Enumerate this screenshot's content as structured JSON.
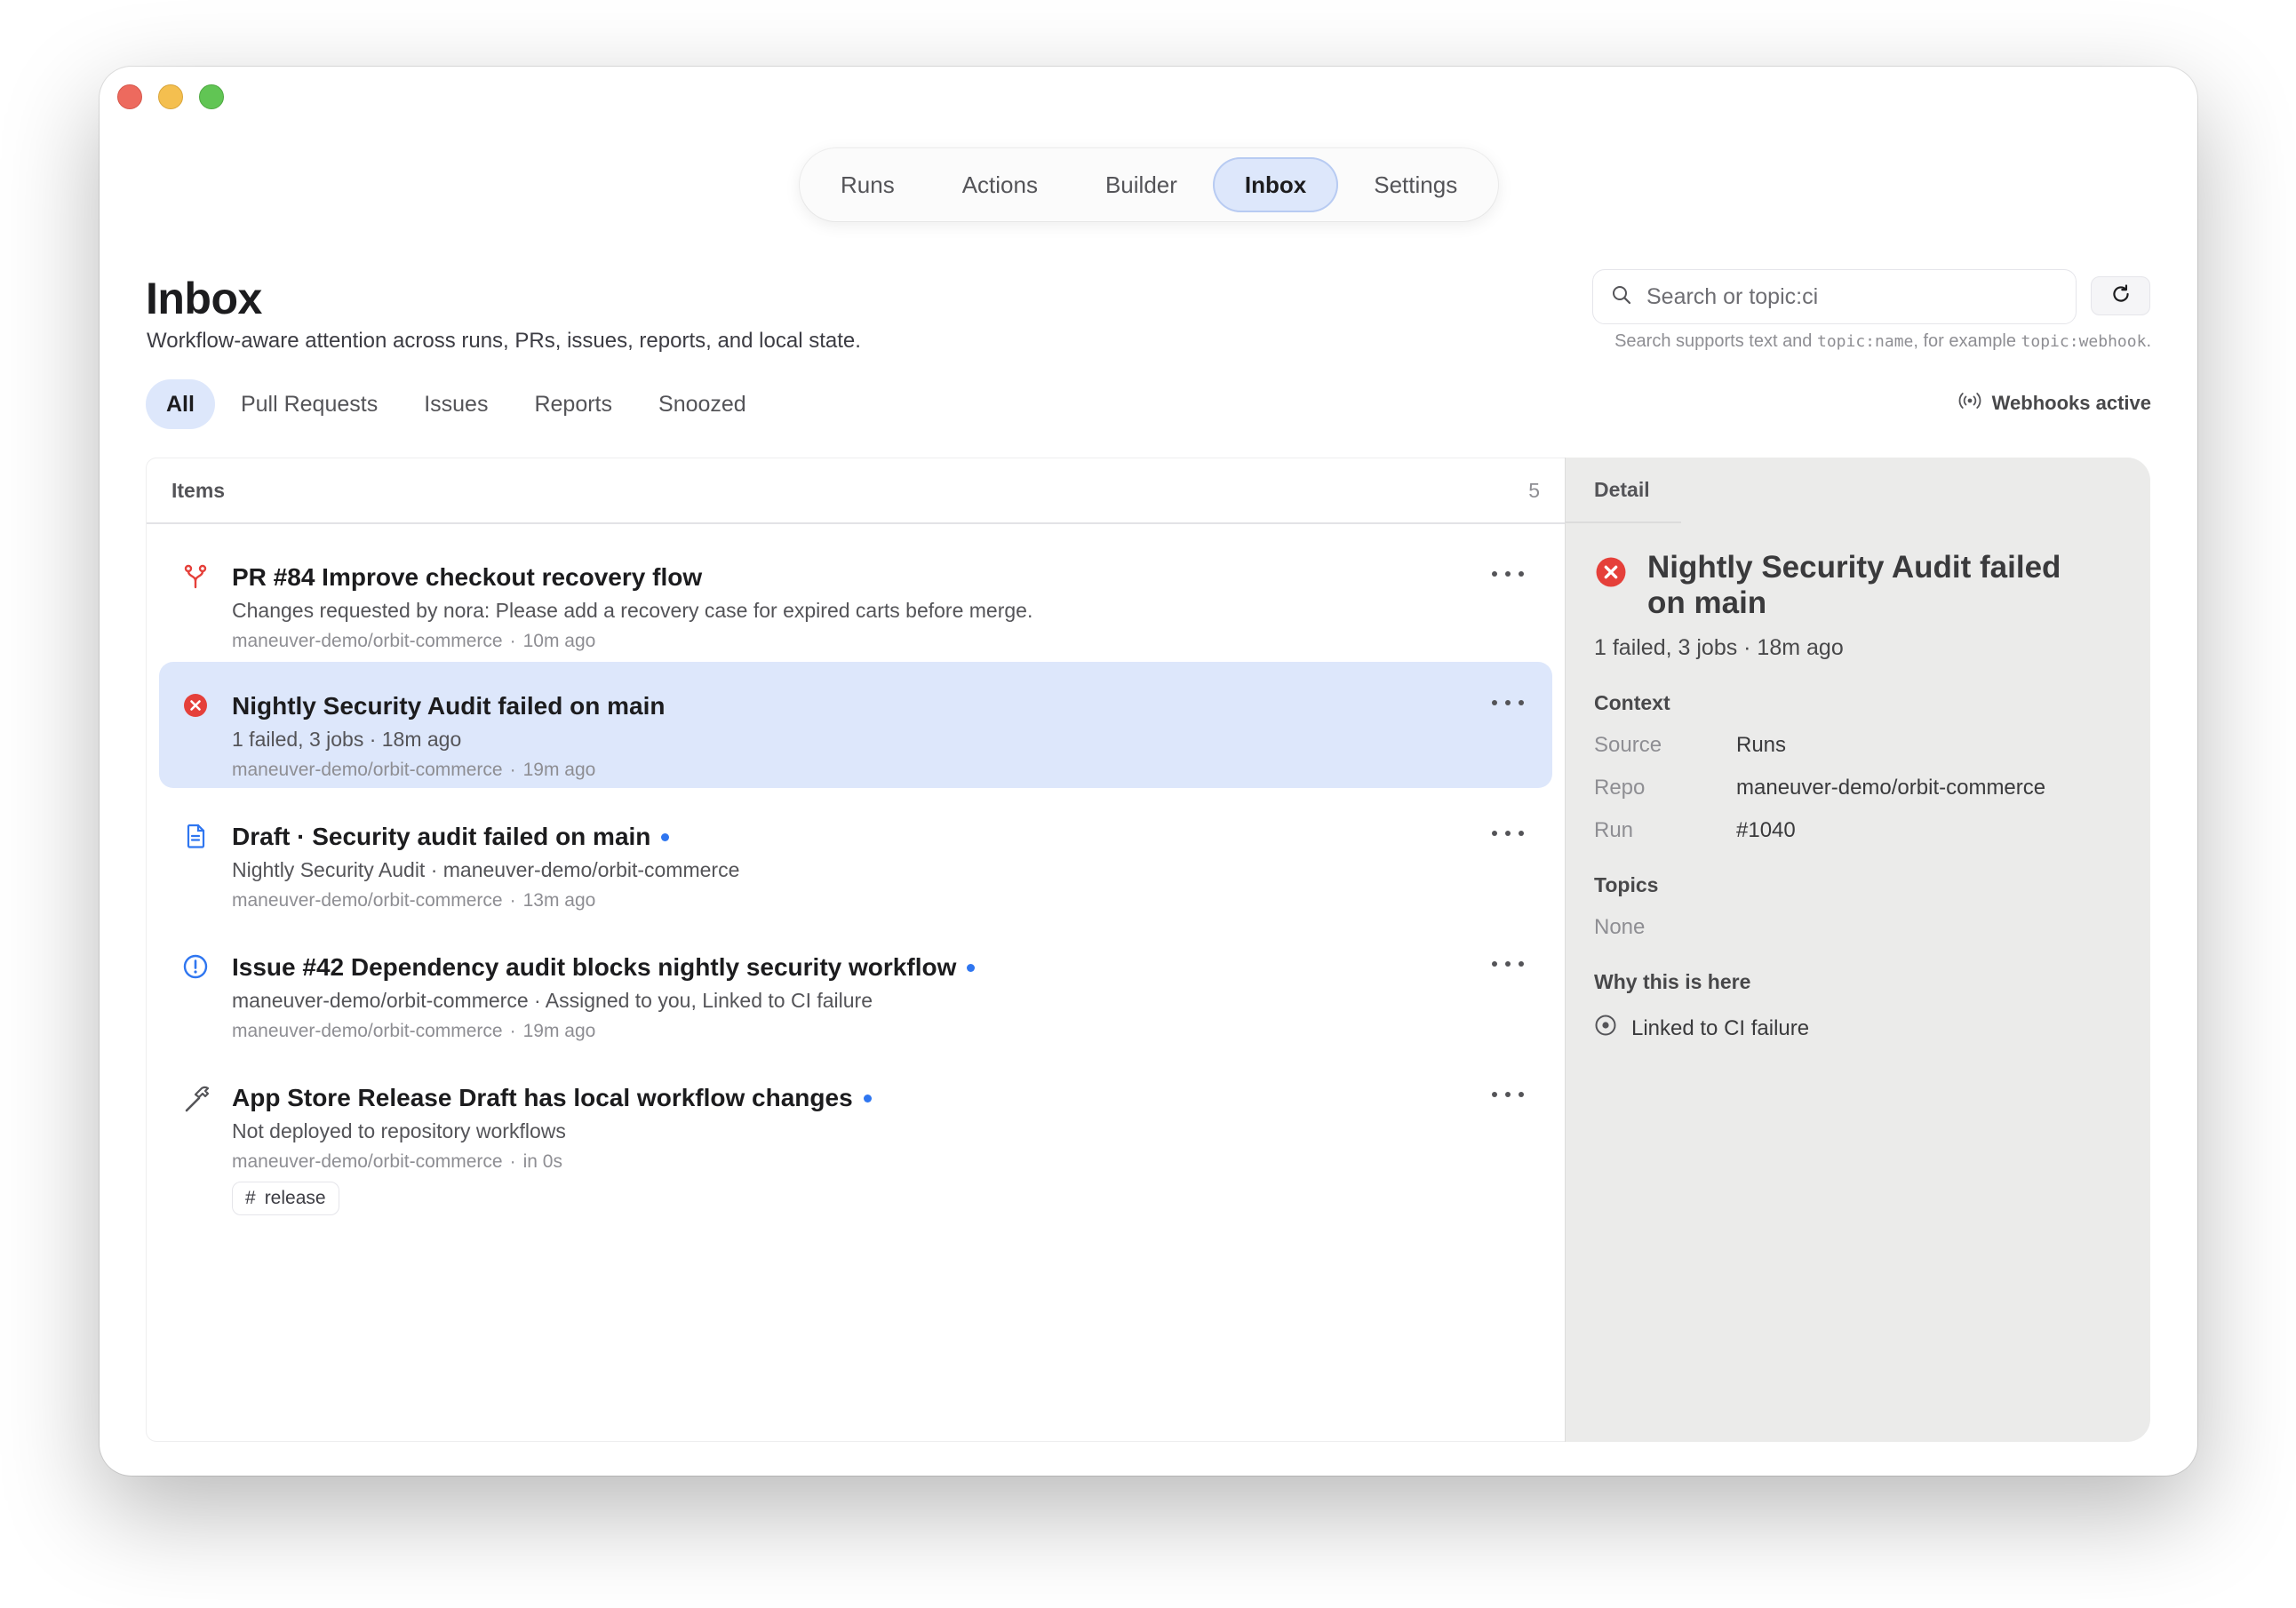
{
  "nav": {
    "tabs": [
      {
        "label": "Runs"
      },
      {
        "label": "Actions"
      },
      {
        "label": "Builder"
      },
      {
        "label": "Inbox",
        "active": true
      },
      {
        "label": "Settings"
      }
    ]
  },
  "page": {
    "title": "Inbox",
    "subtitle": "Workflow-aware attention across runs, PRs, issues, reports, and local state."
  },
  "search": {
    "placeholder": "Search or topic:ci",
    "hint_prefix": "Search supports text and ",
    "hint_code1": "topic:name",
    "hint_middle": ", for example ",
    "hint_code2": "topic:webhook",
    "hint_suffix": "."
  },
  "filters": [
    {
      "label": "All",
      "active": true
    },
    {
      "label": "Pull Requests"
    },
    {
      "label": "Issues"
    },
    {
      "label": "Reports"
    },
    {
      "label": "Snoozed"
    }
  ],
  "webhooks": {
    "label": "Webhooks active"
  },
  "list": {
    "header": "Items",
    "count": "5",
    "items": [
      {
        "icon": "pull-request-icon",
        "title": "PR #84 Improve checkout recovery flow",
        "description": "Changes requested by nora: Please add a recovery case for expired carts before merge.",
        "repo": "maneuver-demo/orbit-commerce",
        "time": "10m ago",
        "unread": false
      },
      {
        "icon": "failed-icon",
        "title": "Nightly Security Audit failed on main",
        "description": "1 failed, 3 jobs · 18m ago",
        "repo": "maneuver-demo/orbit-commerce",
        "time": "19m ago",
        "unread": false,
        "selected": true
      },
      {
        "icon": "document-icon",
        "title": "Draft · Security audit failed on main",
        "description": "Nightly Security Audit · maneuver-demo/orbit-commerce",
        "repo": "maneuver-demo/orbit-commerce",
        "time": "13m ago",
        "unread": true
      },
      {
        "icon": "issue-icon",
        "title": "Issue #42 Dependency audit blocks nightly security workflow",
        "description": "maneuver-demo/orbit-commerce · Assigned to you, Linked to CI failure",
        "repo": "maneuver-demo/orbit-commerce",
        "time": "19m ago",
        "unread": true
      },
      {
        "icon": "hammer-icon",
        "title": "App Store Release Draft has local workflow changes",
        "description": "Not deployed to repository workflows",
        "repo": "maneuver-demo/orbit-commerce",
        "time": "in 0s",
        "unread": true,
        "tag": "release"
      }
    ]
  },
  "detail": {
    "header": "Detail",
    "title": "Nightly Security Audit failed on main",
    "subtitle": "1 failed, 3 jobs · 18m ago",
    "context_title": "Context",
    "context": [
      {
        "key": "Source",
        "value": "Runs"
      },
      {
        "key": "Repo",
        "value": "maneuver-demo/orbit-commerce"
      },
      {
        "key": "Run",
        "value": "#1040"
      }
    ],
    "topics_title": "Topics",
    "topics_value": "None",
    "why_title": "Why this is here",
    "why_value": "Linked to CI failure"
  },
  "colors": {
    "accent": "#2f76f0",
    "selected_bg": "#dde7fb",
    "failure_red": "#e5403a"
  }
}
